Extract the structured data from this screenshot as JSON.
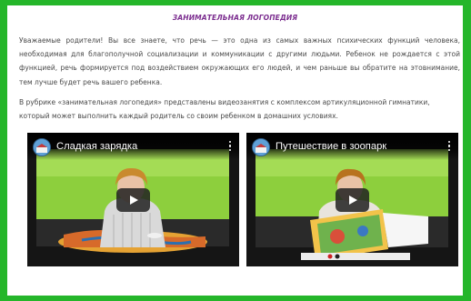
{
  "article": {
    "title": "ЗАНИМАТЕЛЬНАЯ ЛОГОПЕДИЯ",
    "paragraph1": "Уважаемые родители! Вы все знаете, что речь — это одна из самых важных психических функций человека, необходимая для благополучной социализации и коммуникации с другими людьми. Ребенок не рождается с этой функцией, речь формируется под воздействием окружающих его людей, и чем раньше вы обратите на этовнимание, тем лучше будет речь вашего ребенка.",
    "paragraph2": "В рубрике «занимательная логопедия» представлены видеозанятия с комплексом артикуляционной гимнатики, который может выполнить  каждый родитель со своим ребенком в домашних условиях."
  },
  "videos": [
    {
      "title": "Сладкая зарядка",
      "channel_icon": "channel-avatar-icon",
      "menu_icon": "more-vertical-icon",
      "play_icon": "youtube-play-icon"
    },
    {
      "title": "Путешествие в зоопарк",
      "channel_icon": "channel-avatar-icon",
      "menu_icon": "more-vertical-icon",
      "play_icon": "youtube-play-icon"
    }
  ],
  "colors": {
    "frame_border": "#25b62a",
    "title": "#7b2c8f",
    "body_text": "#4a4a4a",
    "play_button": "#212121"
  }
}
